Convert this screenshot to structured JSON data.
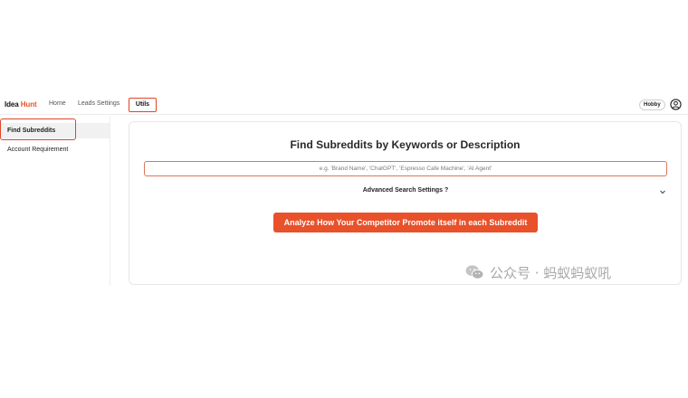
{
  "app": {
    "logo_part1": "Idea",
    "logo_part2": "Hunt"
  },
  "nav": {
    "home": "Home",
    "leads_settings": "Leads Settings",
    "utils": "Utils"
  },
  "header": {
    "plan_badge": "Hobby",
    "user_icon": "user-circle-icon"
  },
  "sidebar": {
    "items": [
      {
        "label": "Find Subreddits",
        "active": true
      },
      {
        "label": "Account Requirement",
        "active": false
      }
    ]
  },
  "main": {
    "title": "Find Subreddits by Keywords or Description",
    "search_placeholder": "e.g. 'Brand Name', 'ChatGPT', 'Espresso Cafe Machine', 'AI Agent'",
    "advanced_label": "Advanced Search Settings ?",
    "advanced_icon": "chevron-down-icon",
    "cta_label": "Analyze How Your Competitor Promote itself in each Subreddit"
  },
  "watermark": {
    "icon": "wechat-icon",
    "text": "公众号 · 蚂蚁蚂蚁吼"
  },
  "colors": {
    "accent": "#e8512a",
    "highlight_border": "#e0452a"
  }
}
